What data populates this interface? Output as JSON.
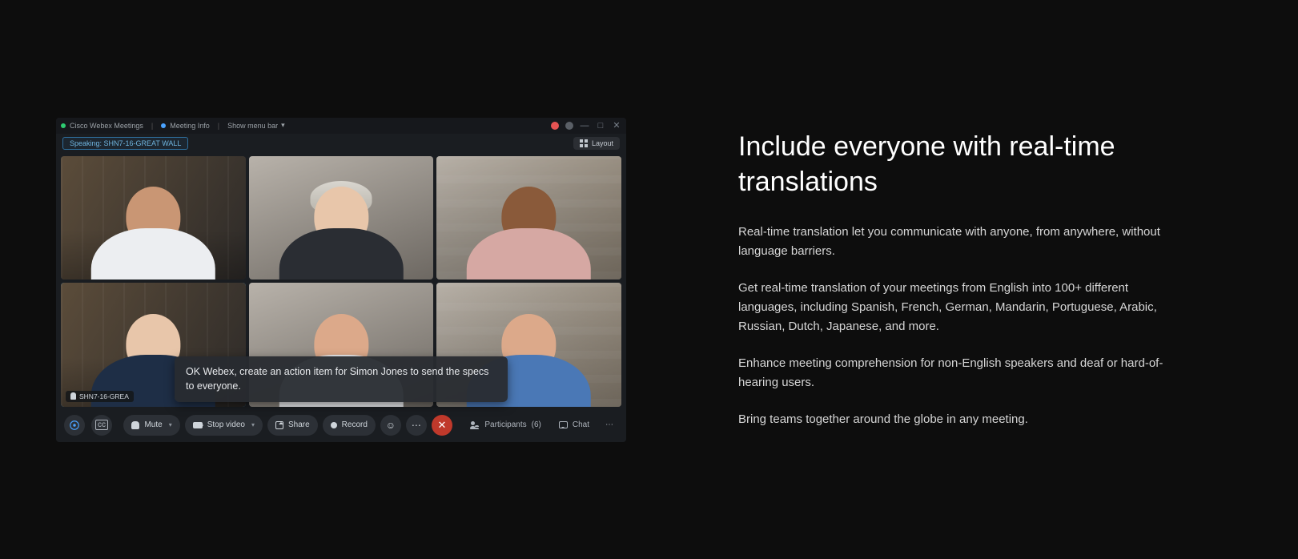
{
  "meeting": {
    "app_title": "Cisco Webex Meetings",
    "meeting_info_label": "Meeting Info",
    "show_menu_label": "Show menu bar",
    "speaking_pill_prefix": "Speaking: ",
    "speaking_name": "SHN7-16-GREAT WALL",
    "layout_label": "Layout",
    "participant_name_tag": "SHN7-16-GREA",
    "caption_text": "OK Webex, create an action item for Simon Jones to send the specs to everyone.",
    "controls": {
      "mute": "Mute",
      "stop_video": "Stop video",
      "share": "Share",
      "record": "Record",
      "participants_label": "Participants",
      "participants_count": "(6)",
      "chat": "Chat"
    }
  },
  "copy": {
    "heading": "Include everyone with real-time translations",
    "p1": "Real-time translation let you communicate with anyone, from anywhere, without language barriers.",
    "p2": "Get real-time translation of your meetings from English into 100+ different languages, including Spanish, French, German, Mandarin, Portuguese, Arabic, Russian, Dutch, Japanese, and more.",
    "p3": "Enhance meeting comprehension for non-English speakers and deaf or hard-of-hearing users.",
    "p4": "Bring teams together around the globe in any meeting."
  }
}
